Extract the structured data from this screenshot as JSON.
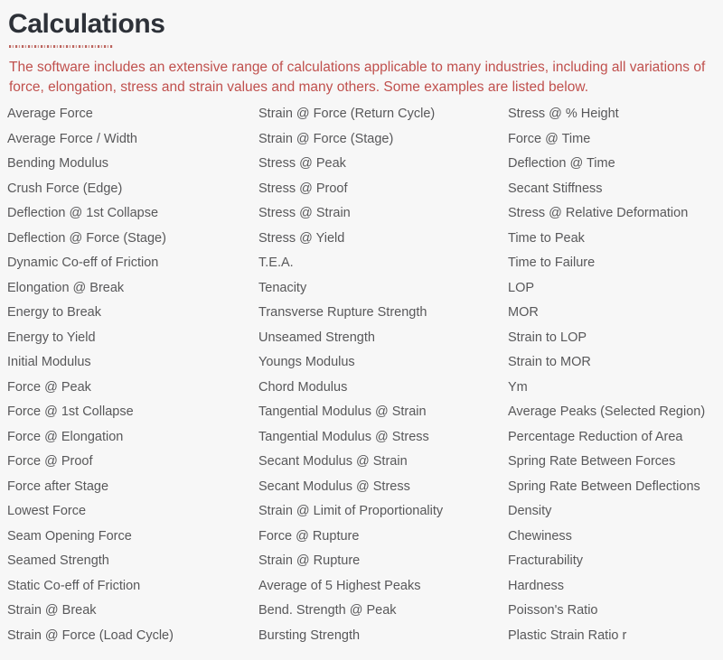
{
  "page": {
    "title": "Calculations",
    "intro": "The software includes an extensive range of calculations applicable to many industries, including all variations of force, elongation, stress and strain values and many others. Some examples are listed below.",
    "colors": {
      "background": "#f7f7f7",
      "title": "#2d3138",
      "intro_text": "#c0504d",
      "list_text": "#58585a",
      "rule_accent": "#b24b44"
    }
  },
  "columns": [
    {
      "items": [
        "Average Force",
        "Average Force / Width",
        "Bending Modulus",
        "Crush Force (Edge)",
        "Deflection @ 1st Collapse",
        "Deflection @ Force (Stage)",
        "Dynamic Co-eff of Friction",
        "Elongation @ Break",
        "Energy to Break",
        "Energy to Yield",
        "Initial Modulus",
        "Force @ Peak",
        "Force @ 1st Collapse",
        "Force @ Elongation",
        "Force @ Proof",
        "Force after Stage",
        "Lowest Force",
        "Seam Opening Force",
        "Seamed Strength",
        "Static Co-eff of Friction",
        "Strain @ Break",
        "Strain @ Force (Load Cycle)"
      ]
    },
    {
      "items": [
        "Strain @ Force (Return Cycle)",
        "Strain @ Force (Stage)",
        "Stress @ Peak",
        "Stress @ Proof",
        "Stress @ Strain",
        "Stress @ Yield",
        "T.E.A.",
        "Tenacity",
        "Transverse Rupture Strength",
        "Unseamed Strength",
        "Youngs Modulus",
        "Chord Modulus",
        "Tangential Modulus @ Strain",
        "Tangential Modulus @ Stress",
        "Secant Modulus @ Strain",
        "Secant Modulus @ Stress",
        "Strain @ Limit of Proportionality",
        "Force @ Rupture",
        "Strain @ Rupture",
        "Average of 5 Highest Peaks",
        "Bend. Strength @ Peak",
        "Bursting Strength"
      ]
    },
    {
      "items": [
        "Stress @ % Height",
        "Force @ Time",
        "Deflection @ Time",
        "Secant Stiffness",
        "Stress @ Relative Deformation",
        "Time to Peak",
        "Time to Failure",
        "LOP",
        "MOR",
        "Strain to LOP",
        "Strain to MOR",
        "Ym",
        "Average Peaks (Selected Region)",
        "Percentage Reduction of Area",
        "Spring Rate Between Forces",
        "Spring Rate Between Deflections",
        "Density",
        "Chewiness",
        "Fracturability",
        "Hardness",
        "Poisson's Ratio",
        "Plastic Strain Ratio r"
      ]
    }
  ]
}
